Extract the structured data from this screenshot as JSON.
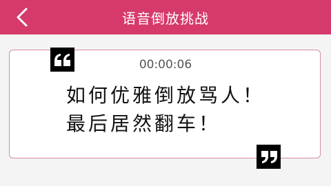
{
  "header": {
    "title": "语音倒放挑战",
    "back_icon": "chevron-left-icon",
    "background_color": "#d63a6a"
  },
  "card": {
    "timer": "00:00:06",
    "lines": [
      "如何优雅倒放骂人！",
      "最后居然翻车！"
    ],
    "open_quote_icon": "open-quote-icon",
    "close_quote_icon": "close-quote-icon",
    "border_color": "#d88aa5"
  }
}
